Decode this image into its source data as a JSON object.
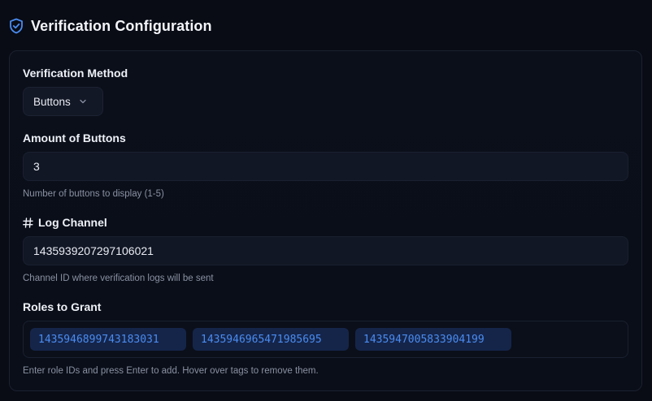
{
  "header": {
    "title": "Verification Configuration",
    "icon": "shield-check-icon",
    "accent": "#4a8cf0"
  },
  "method": {
    "label": "Verification Method",
    "selected": "Buttons"
  },
  "buttons_amount": {
    "label": "Amount of Buttons",
    "value": "3",
    "hint": "Number of buttons to display (1-5)"
  },
  "log_channel": {
    "label": "Log Channel",
    "icon": "hash-icon",
    "value": "1435939207297106021",
    "hint": "Channel ID where verification logs will be sent"
  },
  "roles": {
    "label": "Roles to Grant",
    "tags": [
      "1435946899743183031",
      "1435946965471985695",
      "1435947005833904199"
    ],
    "hint": "Enter role IDs and press Enter to add. Hover over tags to remove them."
  }
}
